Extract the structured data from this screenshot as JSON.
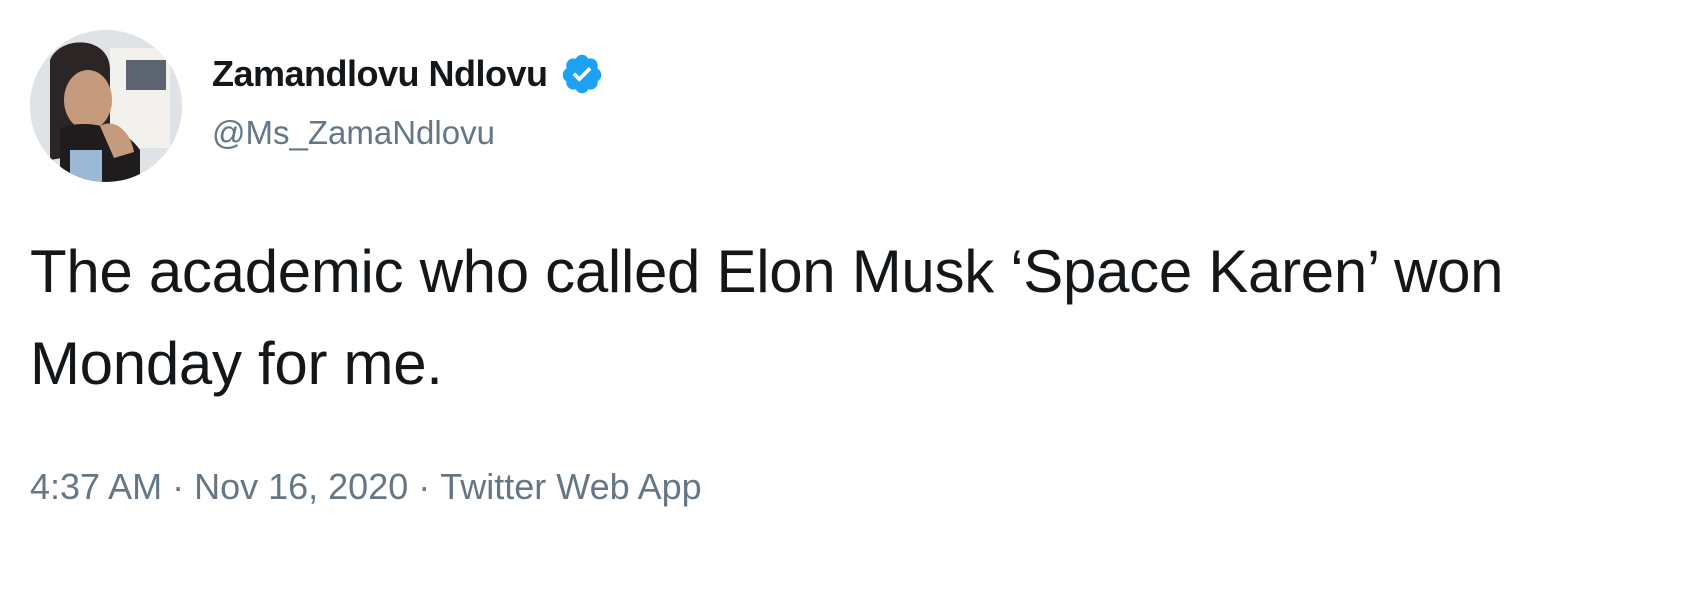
{
  "author": {
    "display_name": "Zamandlovu Ndlovu",
    "handle": "@Ms_ZamaNdlovu",
    "verified_icon": "verified-badge-icon",
    "verified_color": "#1da1f2"
  },
  "tweet": {
    "text": "The academic who called Elon Musk ‘Space Karen’ won Monday for me."
  },
  "meta": {
    "time": "4:37 AM",
    "separator": "·",
    "date": "Nov 16, 2020",
    "source": "Twitter Web App"
  }
}
